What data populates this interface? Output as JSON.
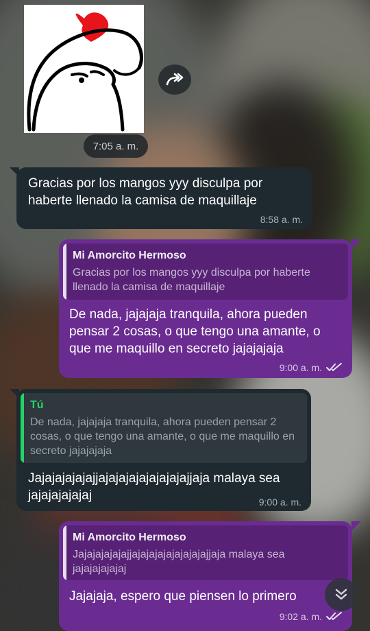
{
  "chat": {
    "sticker_time": "7:05 a. m.",
    "messages": [
      {
        "direction": "incoming",
        "text": "Gracias por los mangos yyy disculpa por haberte llenado la camisa de maquillaje",
        "time": "8:58 a. m."
      },
      {
        "direction": "outgoing",
        "quoted_name": "Mi Amorcito Hermoso",
        "quoted_text": "Gracias por los mangos yyy disculpa por haberte llenado la camisa de maquillaje",
        "text": "De nada, jajajaja tranquila, ahora pueden pensar 2 cosas, o que tengo una amante, o que me maquillo en secreto jajajajaja",
        "time": "9:00 a. m.",
        "status": "read"
      },
      {
        "direction": "incoming",
        "quoted_name": "Tú",
        "quoted_text": "De nada, jajajaja tranquila, ahora pueden pensar 2 cosas, o que tengo una amante, o que me maquillo en secreto jajajajaja",
        "text": "Jajajajajajajjajajajajajajajajajjaja malaya sea jajajajajajaj",
        "time": "9:00 a. m."
      },
      {
        "direction": "outgoing",
        "quoted_name": "Mi Amorcito Hermoso",
        "quoted_text": "Jajajajajajajjajajajajajajajajajjaja malaya sea jajajajajajaj",
        "text": "Jajajaja, espero que piensen lo primero",
        "time": "9:02 a. m.",
        "status": "read"
      }
    ]
  },
  "icons": {
    "forward": "forward-icon",
    "read_receipt": "double-check-icon",
    "scroll_down": "chevron-double-down-icon",
    "sticker": "heart-character-sticker"
  },
  "colors": {
    "incoming_bubble": "#1f2a30",
    "outgoing_bubble": "#6b2c92",
    "quote_accent_self": "#25d366"
  }
}
